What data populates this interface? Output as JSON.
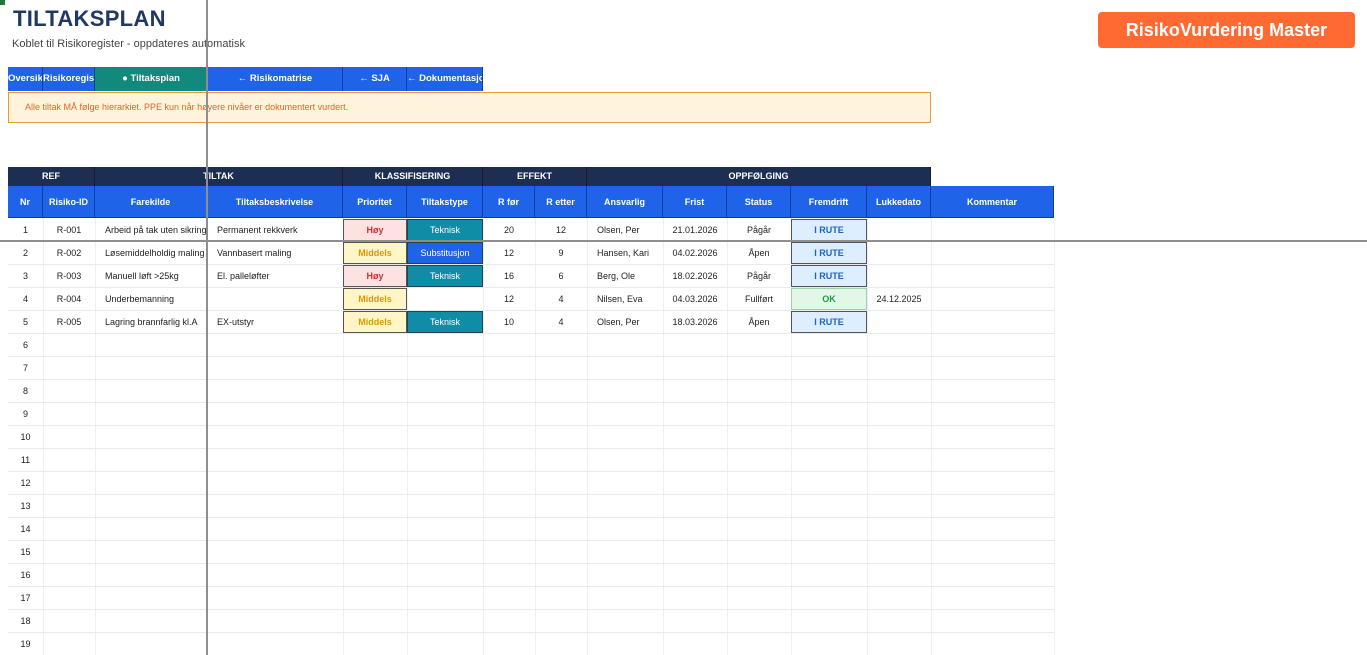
{
  "header": {
    "title": "TILTAKSPLAN",
    "subtitle": "Koblet til Risikoregister - oppdateres automatisk",
    "brand": "RisikoVurdering Master"
  },
  "nav": {
    "tabs": [
      {
        "label": "Oversikt"
      },
      {
        "label": "Risikoregister"
      },
      {
        "label": "● Tiltaksplan"
      },
      {
        "label": "← Risikomatrise"
      },
      {
        "label": "← SJA"
      },
      {
        "label": "← Dokumentasjon"
      }
    ]
  },
  "alert": {
    "text": "Alle tiltak MÅ følge hierarkiet. PPE kun når høyere nivåer er dokumentert vurdert."
  },
  "table": {
    "groups": [
      "REF",
      "TILTAK",
      "KLASSIFISERING",
      "EFFEKT",
      "OPPFØLGING"
    ],
    "columns": [
      "Nr",
      "Risiko-ID",
      "Farekilde",
      "Tiltaksbeskrivelse",
      "Prioritet",
      "Tiltakstype",
      "R før",
      "R etter",
      "Ansvarlig",
      "Frist",
      "Status",
      "Fremdrift",
      "Lukkedato",
      "Kommentar"
    ],
    "rows": [
      {
        "nr": "1",
        "risk_id": "R-001",
        "hazard": "Arbeid på tak uten sikring",
        "measure": "Permanent rekkverk",
        "priority": "Høy",
        "type": "Teknisk",
        "r_before": "20",
        "r_after": "12",
        "owner": "Olsen, Per",
        "deadline": "21.01.2026",
        "status": "Pågår",
        "progress": "I RUTE",
        "closed": "",
        "comment": ""
      },
      {
        "nr": "2",
        "risk_id": "R-002",
        "hazard": "Løsemiddelholdig maling",
        "measure": "Vannbasert maling",
        "priority": "Middels",
        "type": "Substitusjon",
        "r_before": "12",
        "r_after": "9",
        "owner": "Hansen, Kari",
        "deadline": "04.02.2026",
        "status": "Åpen",
        "progress": "I RUTE",
        "closed": "",
        "comment": ""
      },
      {
        "nr": "3",
        "risk_id": "R-003",
        "hazard": "Manuell løft >25kg",
        "measure": "El. palleløfter",
        "priority": "Høy",
        "type": "Teknisk",
        "r_before": "16",
        "r_after": "6",
        "owner": "Berg, Ole",
        "deadline": "18.02.2026",
        "status": "Pågår",
        "progress": "I RUTE",
        "closed": "",
        "comment": ""
      },
      {
        "nr": "4",
        "risk_id": "R-004",
        "hazard": "Underbemanning",
        "measure": "",
        "priority": "Middels",
        "type": "",
        "r_before": "12",
        "r_after": "4",
        "owner": "Nilsen, Eva",
        "deadline": "04.03.2026",
        "status": "Fullført",
        "progress": "OK",
        "closed": "24.12.2025",
        "comment": ""
      },
      {
        "nr": "5",
        "risk_id": "R-005",
        "hazard": "Lagring brannfarlig kl.A",
        "measure": "EX-utstyr",
        "priority": "Middels",
        "type": "Teknisk",
        "r_before": "10",
        "r_after": "4",
        "owner": "Olsen, Per",
        "deadline": "18.03.2026",
        "status": "Åpen",
        "progress": "I RUTE",
        "closed": "",
        "comment": ""
      }
    ],
    "empty_row_numbers": [
      "6",
      "7",
      "8",
      "9",
      "10",
      "11",
      "12",
      "13",
      "14",
      "15",
      "16",
      "17",
      "18",
      "19"
    ]
  }
}
